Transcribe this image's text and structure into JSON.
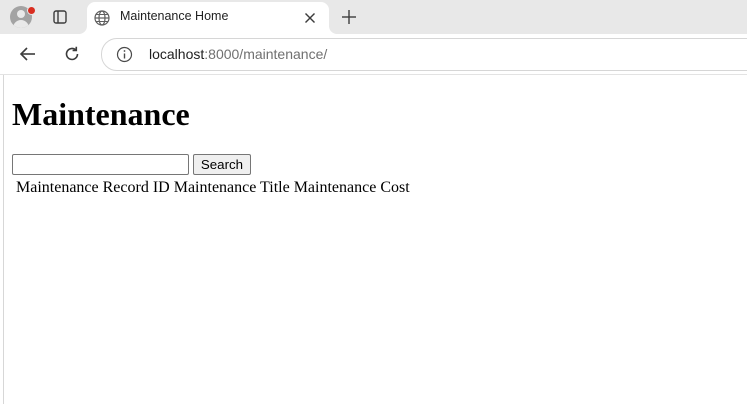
{
  "browser": {
    "tab": {
      "title": "Maintenance Home"
    },
    "address_bar": {
      "host": "localhost",
      "path": ":8000/maintenance/"
    },
    "colors": {
      "tabstrip": "#e8e8e8",
      "profile_badge": "#d92d20"
    },
    "icons": [
      "avatar-icon",
      "tab-actions-icon",
      "globe-icon",
      "close-icon",
      "plus-icon",
      "back-arrow-icon",
      "reload-icon",
      "info-icon"
    ]
  },
  "page": {
    "heading": "Maintenance",
    "search": {
      "value": "",
      "placeholder": "",
      "button_label": "Search"
    },
    "table": {
      "headers": [
        "Maintenance Record ID",
        "Maintenance Title",
        "Maintenance Cost"
      ],
      "rows": []
    }
  }
}
